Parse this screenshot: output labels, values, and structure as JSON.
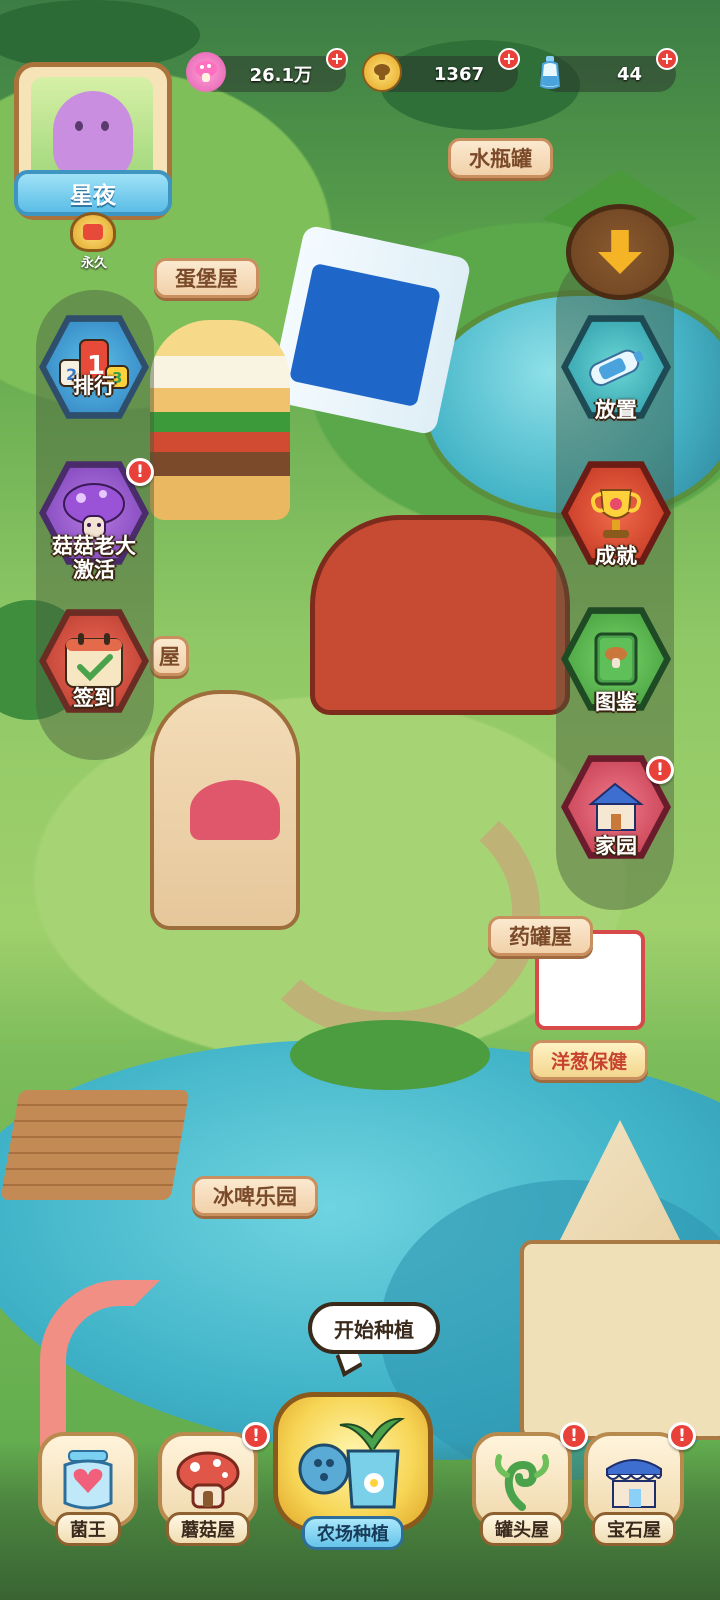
{
  "resources": {
    "mushroom_count": "26.1万",
    "coins": "1367",
    "water": "44",
    "mushroom_icon": "pink-mushroom-icon",
    "coin_icon": "gold-coin-icon",
    "water_icon": "water-bottle-icon",
    "plus_label": "+"
  },
  "player": {
    "name": "星夜",
    "vip_label": "永久"
  },
  "places": {
    "water_jar": "水瓶罐",
    "egg_castle": "蛋堡屋",
    "egg_castle_partial": "屋",
    "medicine_jar": "药罐屋",
    "beer_park": "冰啤乐园",
    "shop_sign": "洋葱保健"
  },
  "left_menu": [
    {
      "label": "排行",
      "icon": "ranking-icon",
      "alert": false
    },
    {
      "label": "菇菇老大\n激活",
      "icon": "mushroom-boss-icon",
      "alert": true
    },
    {
      "label": "签到",
      "icon": "calendar-checkin-icon",
      "alert": false
    }
  ],
  "right_menu": [
    {
      "label": "放置",
      "icon": "water-bottle-place-icon",
      "alert": false
    },
    {
      "label": "成就",
      "icon": "trophy-icon",
      "alert": false
    },
    {
      "label": "图鉴",
      "icon": "encyclopedia-book-icon",
      "alert": false
    },
    {
      "label": "家园",
      "icon": "home-icon",
      "alert": true
    }
  ],
  "alert_mark": "!",
  "planting_prompt": "开始种植",
  "bottom_nav": [
    {
      "label": "菌王",
      "icon": "heart-jar-icon",
      "alert": false
    },
    {
      "label": "蘑菇屋",
      "icon": "mushroom-house-icon",
      "alert": true
    },
    {
      "label": "农场种植",
      "icon": "watering-can-farm-icon",
      "alert": false,
      "active": true
    },
    {
      "label": "罐头屋",
      "icon": "green-swirl-icon",
      "alert": true
    },
    {
      "label": "宝石屋",
      "icon": "gem-shop-icon",
      "alert": true
    }
  ],
  "colors": {
    "alert_red": "#e8413a",
    "name_plate": "#5bbde6",
    "wood": "#b98a4e"
  }
}
